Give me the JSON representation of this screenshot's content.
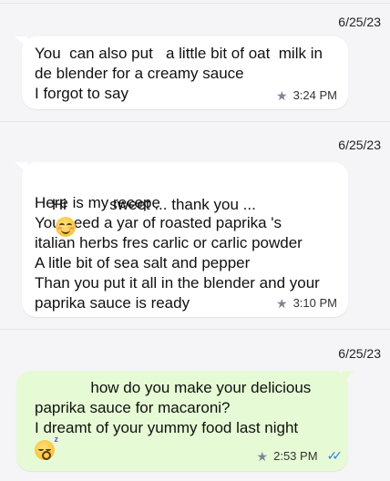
{
  "messages": [
    {
      "date": "6/25/23",
      "direction": "incoming",
      "lines": [
        "You  can also put   a little bit of oat  milk in",
        "de blender for a creamy sauce",
        "I forgot to say"
      ],
      "time": "3:24 PM",
      "starred": true
    },
    {
      "date": "6/25/23",
      "direction": "incoming",
      "lines": [
        "Hi          sweet ... thank you ...",
        "Here is my recepe",
        "You need a yar of roasted paprika 's",
        "italian herbs fres carlic or carlic powder",
        "A litle bit of sea salt and pepper",
        "Than you put it all in the blender and your",
        "paprika sauce is ready"
      ],
      "emoji_first_line": "smiling-blush-emoji",
      "time": "3:10 PM",
      "starred": true
    },
    {
      "date": "6/25/23",
      "direction": "outgoing",
      "lines": [
        "             how do you make your delicious",
        "paprika sauce for macaroni?",
        "I dreamt of your yummy food last night"
      ],
      "emoji_last_line": "sleeping-emoji",
      "time": "2:53 PM",
      "starred": true,
      "read_receipt": "double-check-read"
    }
  ],
  "colors": {
    "background": "#f5f5f7",
    "incoming_bubble": "#ffffff",
    "outgoing_bubble": "#e6fbd5",
    "read_ticks": "#2d7fe0",
    "star": "#7d8795"
  }
}
